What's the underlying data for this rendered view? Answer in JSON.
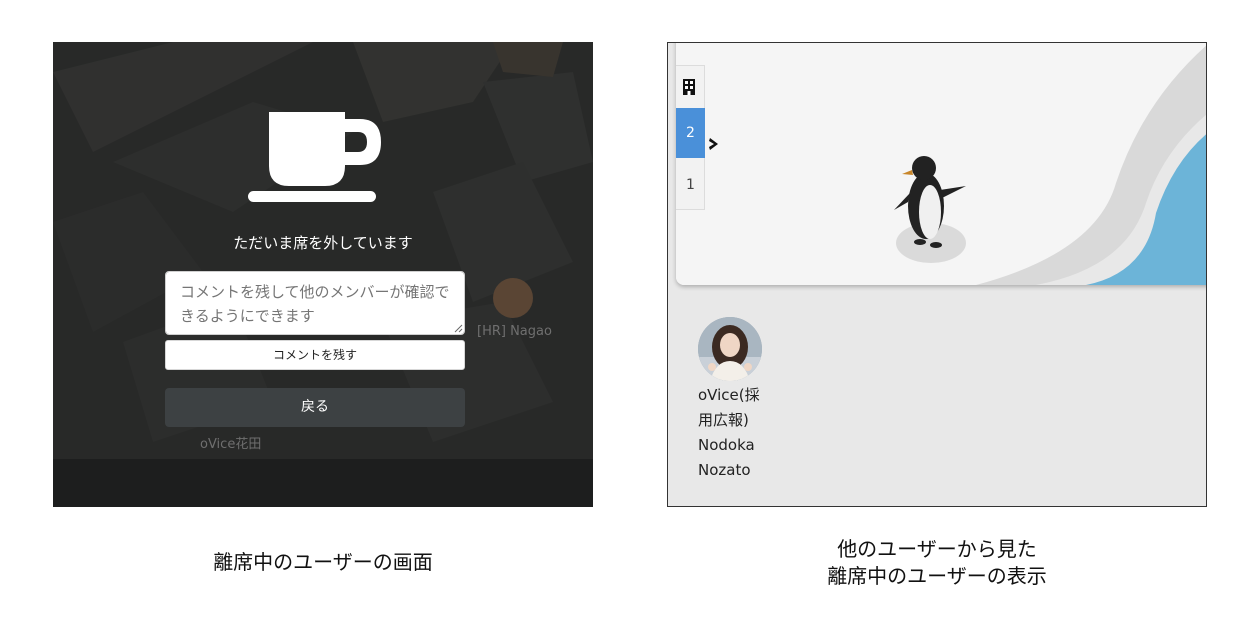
{
  "left_screen": {
    "away_message": "ただいま席を外しています",
    "comment_placeholder": "コメントを残して他のメンバーが確認できるようにできます",
    "leave_comment_label": "コメントを残す",
    "back_label": "戻る",
    "bg_user_1": "oVice花田",
    "bg_user_2": "[HR] Nagao",
    "caption": "離席中のユーザーの画面"
  },
  "right_screen": {
    "floor_tabs": [
      "2",
      "1"
    ],
    "active_floor": "2",
    "user_name_lines": [
      "oVice(採",
      "用広報)",
      "Nodoka",
      "Nozato"
    ],
    "caption_lines": [
      "他のユーザーから見た",
      "離席中のユーザーの表示"
    ]
  },
  "colors": {
    "active_tab": "#4a90d9",
    "water": "#6cb4d8",
    "dark_button": "#3d4143"
  }
}
